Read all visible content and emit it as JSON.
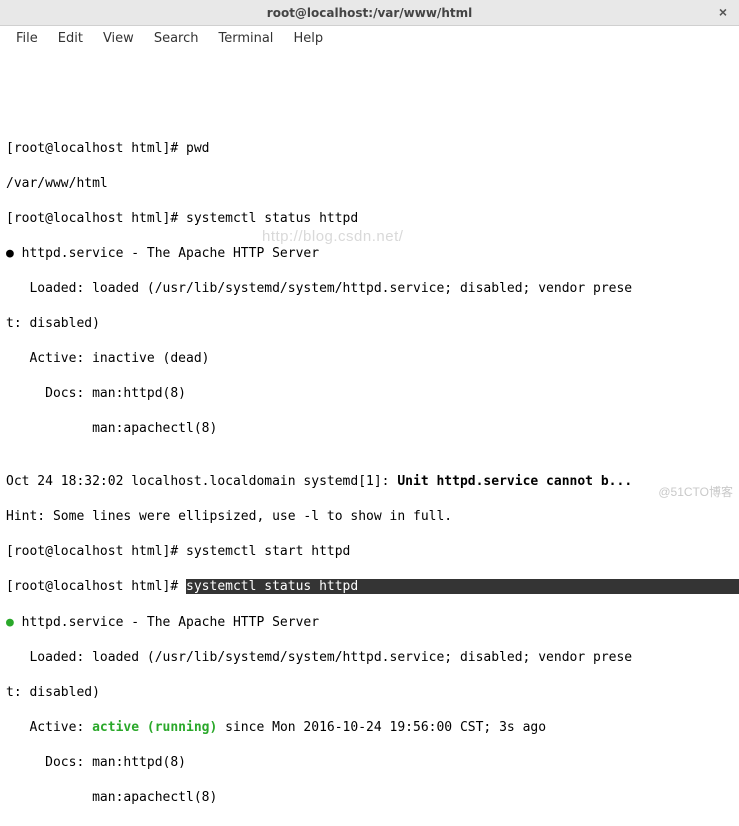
{
  "window": {
    "title": "root@localhost:/var/www/html"
  },
  "menu": {
    "file": "File",
    "edit": "Edit",
    "view": "View",
    "search": "Search",
    "terminal": "Terminal",
    "help": "Help"
  },
  "term": {
    "l0": "",
    "l1": "",
    "l2": "",
    "l3": "",
    "l4": "[root@localhost html]# pwd",
    "l5": "/var/www/html",
    "l6": "[root@localhost html]# systemctl status httpd",
    "l7_bullet": "●",
    "l7_rest": " httpd.service - The Apache HTTP Server",
    "l8": "   Loaded: loaded (/usr/lib/systemd/system/httpd.service; disabled; vendor prese",
    "l9": "t: disabled)",
    "l10": "   Active: inactive (dead)",
    "l11": "     Docs: man:httpd(8)",
    "l12": "           man:apachectl(8)",
    "l13": "",
    "l14_a": "Oct 24 18:32:02 localhost.localdomain systemd[1]: ",
    "l14_b": "Unit httpd.service cannot b...",
    "l15": "Hint: Some lines were ellipsized, use -l to show in full.",
    "l16": "[root@localhost html]# systemctl start httpd",
    "l17_a": "[root@localhost html]# ",
    "l17_sel": "systemctl status httpd",
    "l18_bullet": "●",
    "l18_rest": " httpd.service - The Apache HTTP Server",
    "l19": "   Loaded: loaded (/usr/lib/systemd/system/httpd.service; disabled; vendor prese",
    "l20": "t: disabled)",
    "l21_a": "   Active: ",
    "l21_b": "active (running)",
    "l21_c": " since Mon 2016-10-24 19:56:00 CST; 3s ago",
    "l22": "     Docs: man:httpd(8)",
    "l23": "           man:apachectl(8)"
  },
  "watermark": "http://blog.csdn.net/",
  "footer": "@51CTO博客"
}
